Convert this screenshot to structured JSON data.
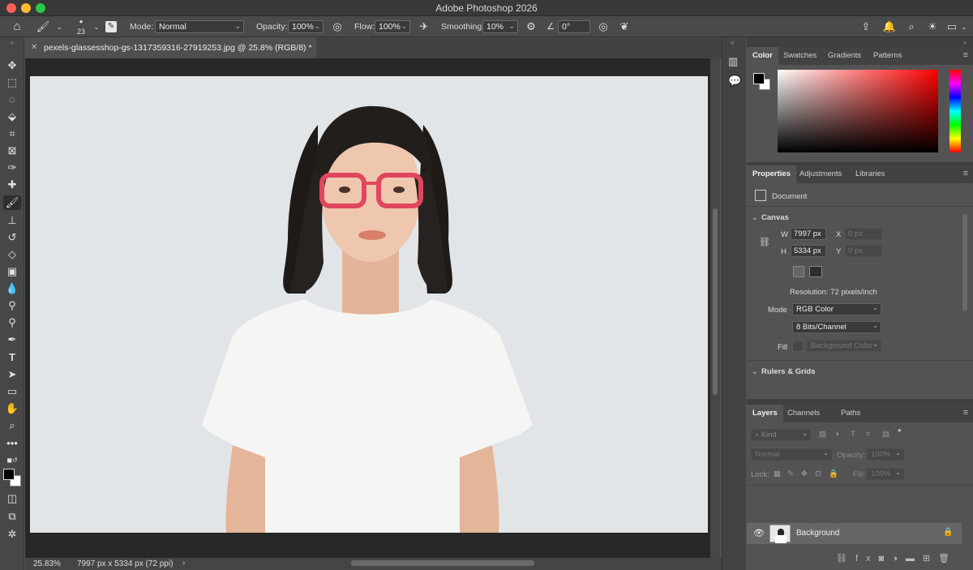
{
  "window": {
    "title": "Adobe Photoshop 2026"
  },
  "options_bar": {
    "brush_size": "23",
    "mode_label": "Mode:",
    "mode_value": "Normal",
    "opacity_label": "Opacity:",
    "opacity_value": "100%",
    "flow_label": "Flow:",
    "flow_value": "100%",
    "smoothing_label": "Smoothing:",
    "smoothing_value": "10%",
    "angle_value": "0°"
  },
  "document": {
    "tab_title": "pexels-glassesshop-gs-1317359316-27919253.jpg @ 25.8% (RGB/8) *"
  },
  "status": {
    "zoom": "25.83%",
    "info": "7997 px x 5334 px (72 ppi)"
  },
  "color_panel": {
    "tabs": [
      "Color",
      "Swatches",
      "Gradients",
      "Patterns"
    ]
  },
  "properties_panel": {
    "tabs": [
      "Properties",
      "Adjustments",
      "Libraries"
    ],
    "doc_label": "Document",
    "canvas_section": "Canvas",
    "w_label": "W",
    "w_value": "7997 px",
    "h_label": "H",
    "h_value": "5334 px",
    "x_label": "X",
    "x_placeholder": "0 px",
    "y_label": "Y",
    "y_placeholder": "0 px",
    "resolution": "Resolution: 72 pixels/inch",
    "mode_label": "Mode",
    "mode_value": "RGB Color",
    "bits_value": "8 Bits/Channel",
    "fill_label": "Fill",
    "fill_value": "Background Color",
    "rulers_section": "Rulers & Grids"
  },
  "layers_panel": {
    "tabs": [
      "Layers",
      "Channels",
      "Paths"
    ],
    "kind_label": "Kind",
    "blend_mode": "Normal",
    "opacity_label": "Opacity:",
    "opacity_value": "100%",
    "lock_label": "Lock:",
    "fill_label": "Fill:",
    "fill_value": "100%",
    "layers": [
      {
        "name": "Background",
        "locked": true,
        "visible": true
      }
    ]
  },
  "colors": {
    "accent": "#ff5f57",
    "foreground": "#000000",
    "background": "#ffffff"
  }
}
